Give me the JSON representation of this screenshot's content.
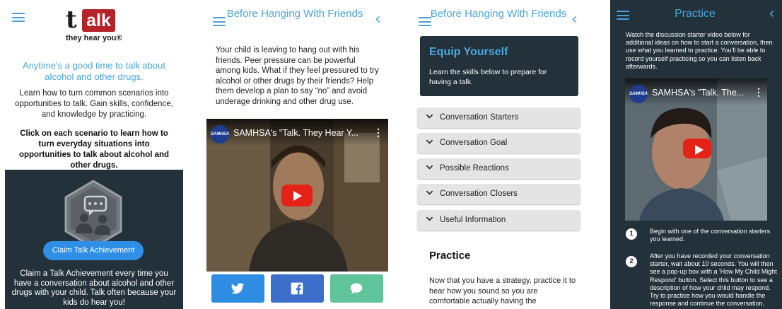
{
  "panel1": {
    "logo_letter": "t",
    "logo_word": "alk",
    "logo_tagline": "they hear you®",
    "headline": "Anytime's a good time to talk about alcohol and other drugs.",
    "body": "Learn how to turn common scenarios into opportunities to talk. Gain skills, confidence, and knowledge by practicing.",
    "bold_text": "Click on each scenario to learn how to turn everyday situations into opportunities to talk about alcohol and other drugs.",
    "claim_button": "Claim Talk Achievement",
    "claim_text": "Claim a Talk Achievement every time you have a conversation about alcohol and other drugs with your child. Talk often because your kids do hear you!"
  },
  "panel2": {
    "title": "Before Hanging With Friends",
    "body": "Your child is leaving to hang out with his friends. Peer pressure can be powerful among kids. What if they feel pressured to try alcohol or other drugs by their friends? Help them develop a plan to say “no” and avoid underage drinking and other drug use.",
    "video_logo": "SAMHSA",
    "video_title": "SAMHSA's \"Talk. They Hear Y...",
    "share": [
      "twitter-icon",
      "facebook-icon",
      "message-icon"
    ]
  },
  "panel3": {
    "title": "Before Hanging With Friends",
    "equip_title": "Equip Yourself",
    "equip_sub": "Learn the skills below to prepare for having a talk.",
    "accordion": [
      {
        "label": "Conversation Starters"
      },
      {
        "label": "Conversation Goal"
      },
      {
        "label": "Possible Reactions"
      },
      {
        "label": "Conversation Closers"
      },
      {
        "label": "Useful Information"
      }
    ],
    "practice_heading": "Practice",
    "practice_body": "Now that you have a strategy, practice it to hear how you sound so you are comfortable actually having the"
  },
  "panel4": {
    "title": "Practice",
    "intro": "Watch the discussion starter video below for additional ideas on how to start a conversation, then use what you learned to practice. You'll be able to record yourself practicing so you can listen back afterwards.",
    "video_logo": "SAMHSA",
    "video_title": "SAMHSA's \"Talk. The...",
    "steps": [
      {
        "num": "1",
        "text": "Begin with one of the conversation starters you learned."
      },
      {
        "num": "2",
        "text": "After you have recorded your conversation starter, wait about 10 seconds. You will then see a pop-up box with a 'How My Child Might Respond' button. Select this button to see a description of how your child may respond. Try to practice how you would handle the response and continue the conversation."
      }
    ]
  },
  "colors": {
    "accent_blue": "#49a6dc",
    "dark_panel": "#22313a",
    "logo_red": "#b52227",
    "youtube_red": "#e62117",
    "twitter": "#2e8ce2",
    "facebook": "#3d6ec9",
    "message": "#5fc39b"
  }
}
